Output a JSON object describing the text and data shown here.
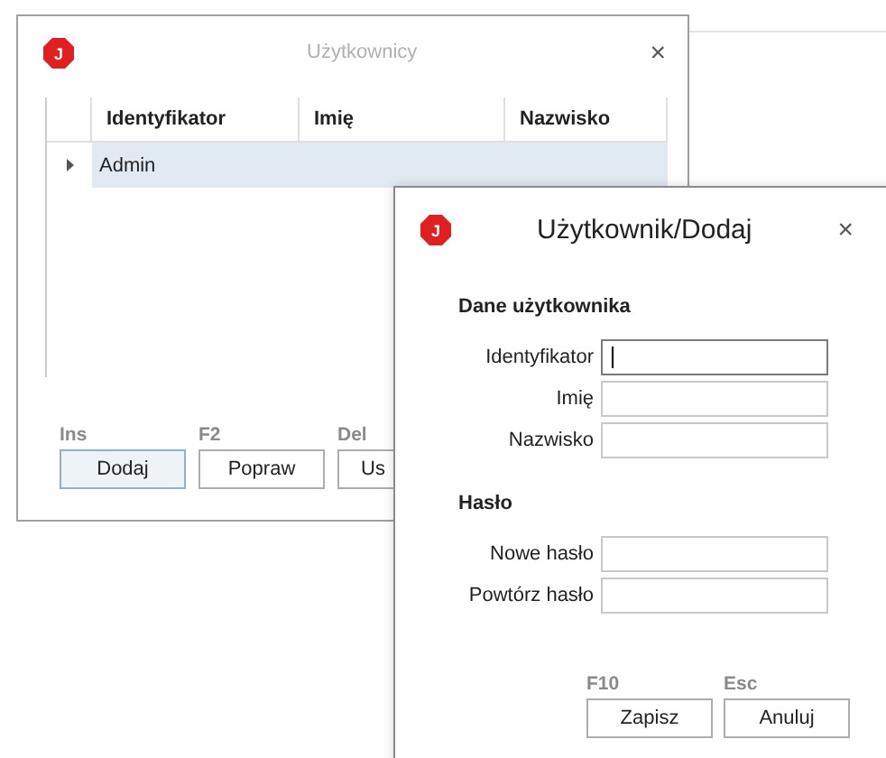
{
  "windows": [
    {
      "kind": "list",
      "title": "Użytkownicy",
      "active": false,
      "logo": "J",
      "close": "×",
      "table": {
        "columns": [
          "Identyfikator",
          "Imię",
          "Nazwisko"
        ],
        "rows": [
          {
            "cells": [
              "Admin"
            ],
            "selected": true
          }
        ]
      },
      "buttons": [
        {
          "shortcut": "Ins",
          "label": "Dodaj",
          "focused": true
        },
        {
          "shortcut": "F2",
          "label": "Popraw",
          "focused": false
        },
        {
          "shortcut": "Del",
          "label": "Us",
          "focused": false
        }
      ]
    },
    {
      "kind": "form",
      "title": "Użytkownik/Dodaj",
      "active": true,
      "logo": "J",
      "close": "×",
      "sections": [
        {
          "title": "Dane użytkownika",
          "fields": [
            {
              "label": "Identyfikator",
              "focused": true
            },
            {
              "label": "Imię",
              "focused": false
            },
            {
              "label": "Nazwisko",
              "focused": false
            }
          ]
        },
        {
          "title": "Hasło",
          "fields": [
            {
              "label": "Nowe hasło",
              "focused": false
            },
            {
              "label": "Powtórz hasło",
              "focused": false
            }
          ]
        }
      ],
      "buttons": [
        {
          "shortcut": "F10",
          "label": "Zapisz",
          "focused": false
        },
        {
          "shortcut": "Esc",
          "label": "Anuluj",
          "focused": false
        }
      ]
    }
  ]
}
